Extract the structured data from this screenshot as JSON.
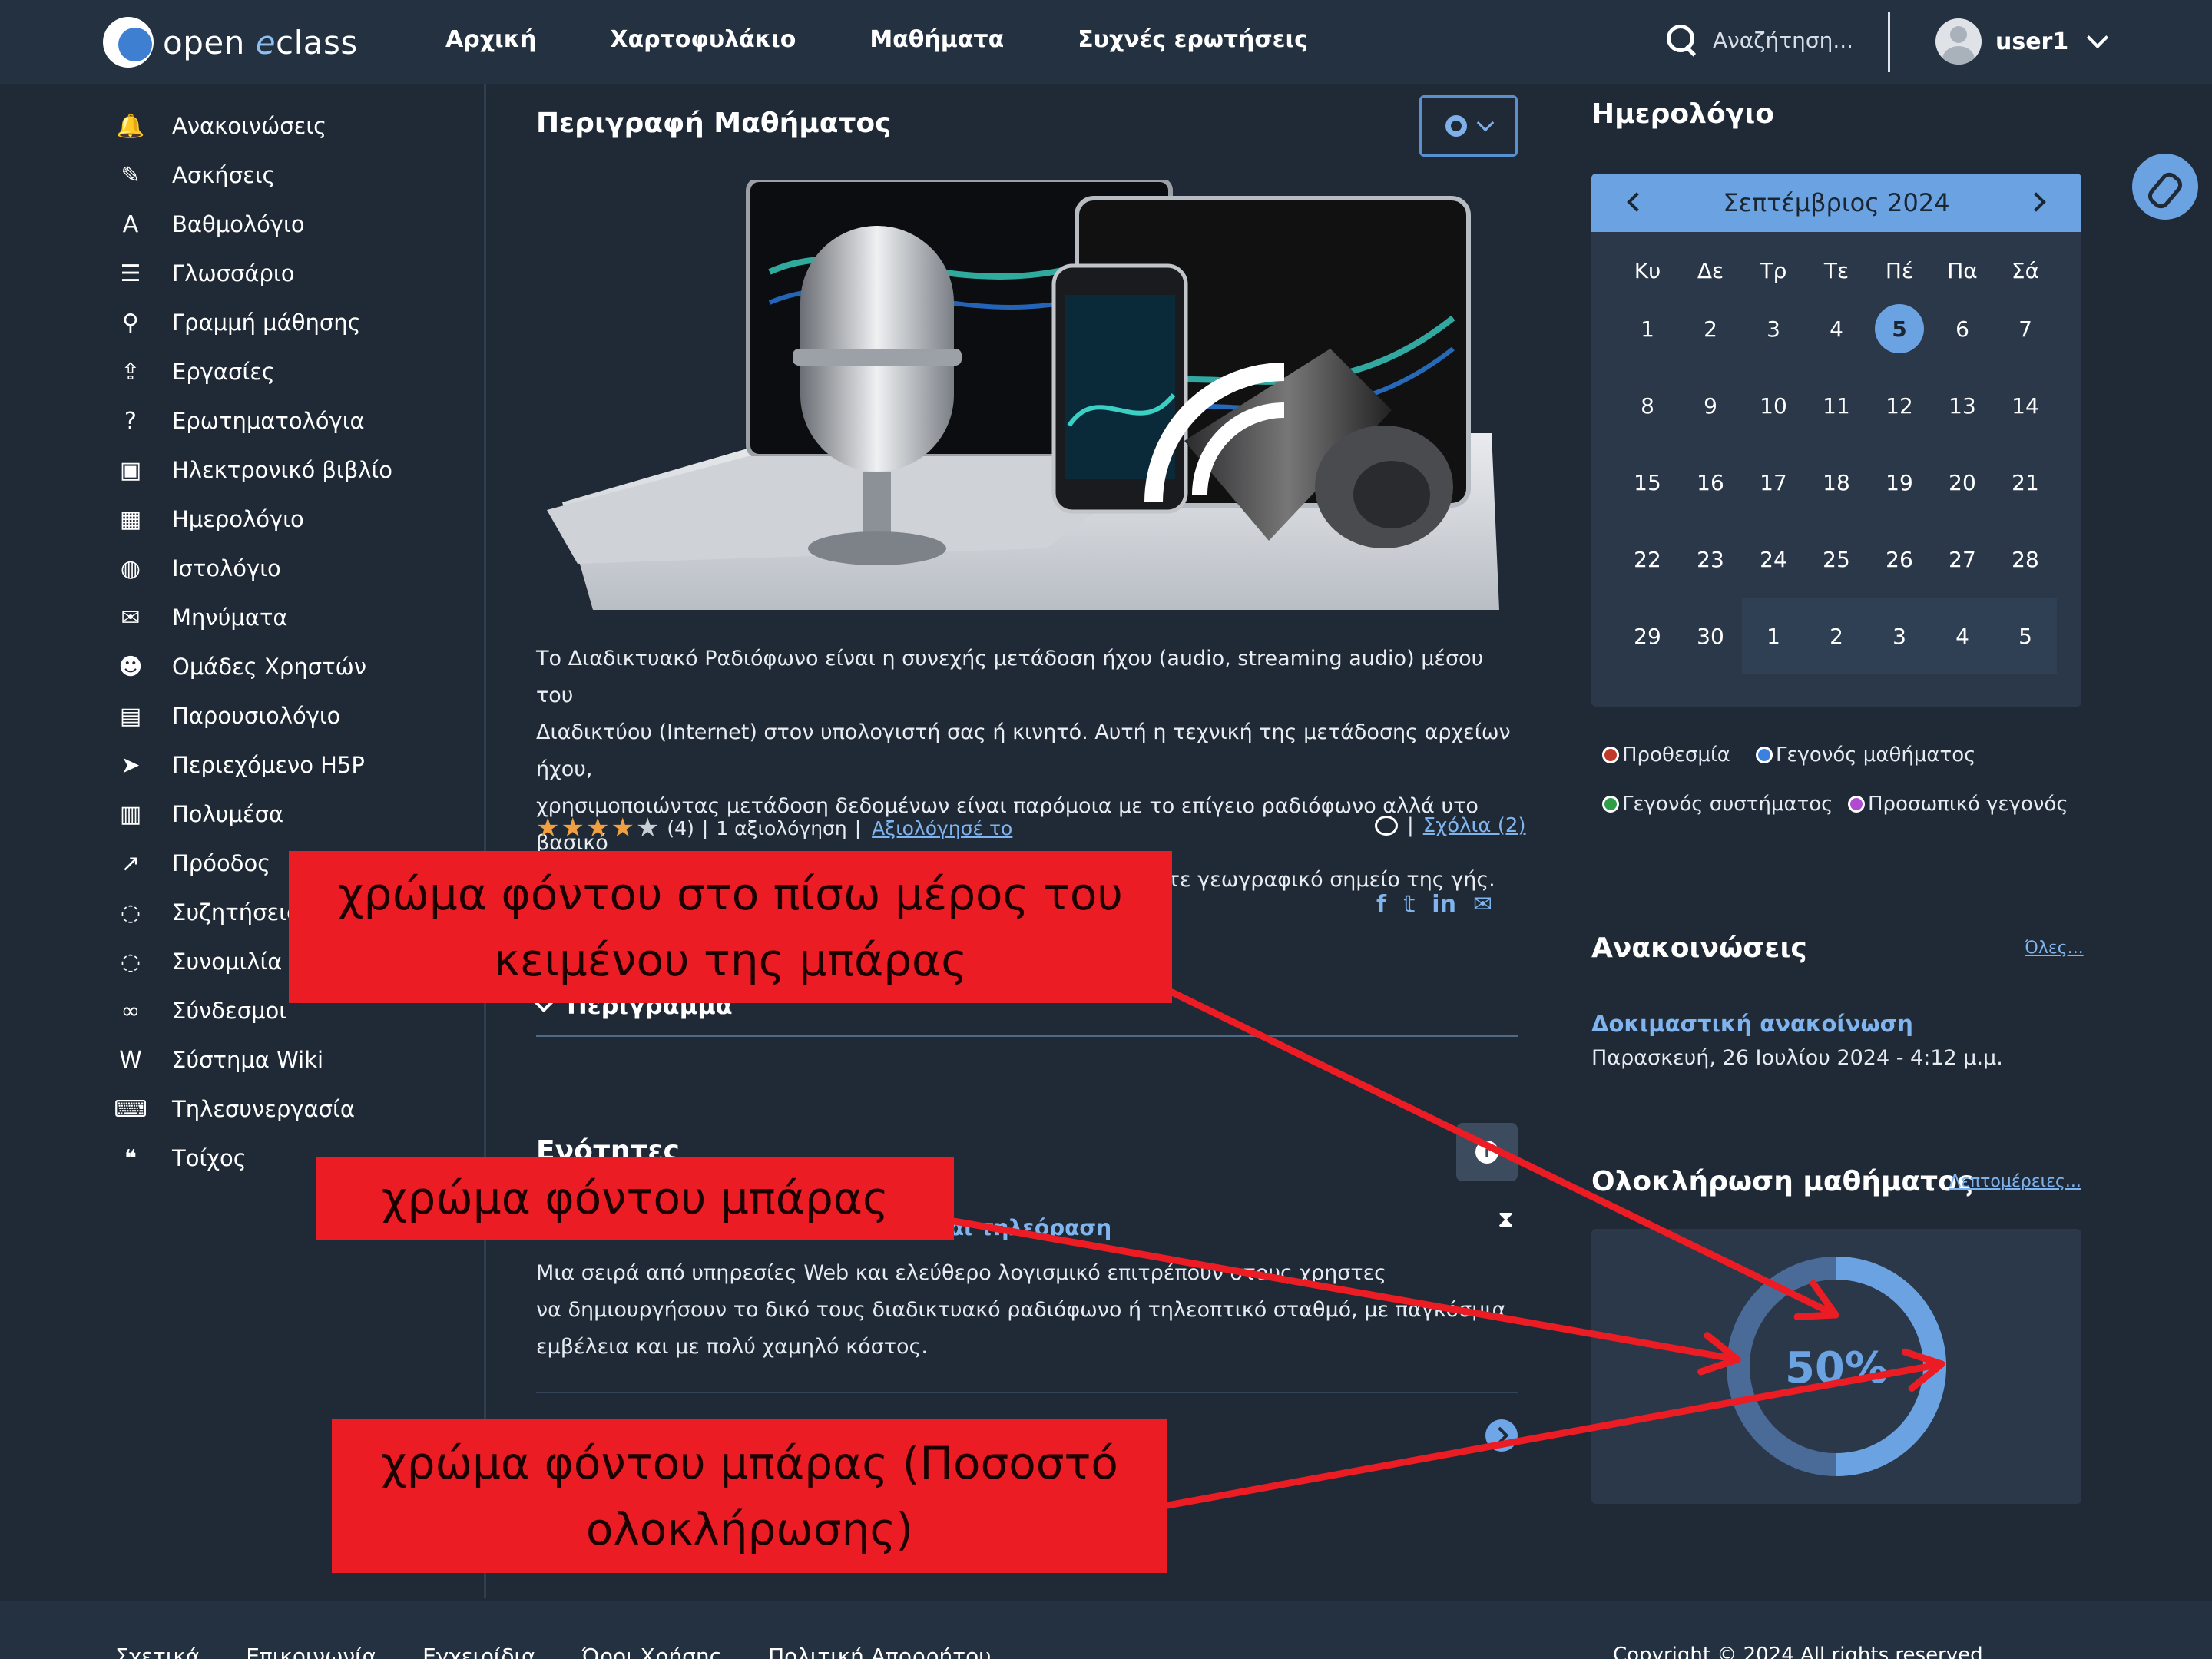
{
  "header": {
    "logo_prefix": "open",
    "logo_e": "e",
    "logo_suffix": "class",
    "nav": [
      "Αρχική",
      "Χαρτοφυλάκιο",
      "Μαθήματα",
      "Συχνές ερωτήσεις"
    ],
    "search_placeholder": "Αναζήτηση...",
    "user": "user1"
  },
  "sidebar": {
    "items": [
      {
        "label": "Ανακοινώσεις",
        "icon": "bell-icon",
        "glyph": "🔔"
      },
      {
        "label": "Ασκήσεις",
        "icon": "edit-file-icon",
        "glyph": "✎"
      },
      {
        "label": "Βαθμολόγιο",
        "icon": "grade-a-icon",
        "glyph": "A"
      },
      {
        "label": "Γλωσσάριο",
        "icon": "list-icon",
        "glyph": "☰"
      },
      {
        "label": "Γραμμή μάθησης",
        "icon": "route-icon",
        "glyph": "⚲"
      },
      {
        "label": "Εργασίες",
        "icon": "upload-icon",
        "glyph": "⇪"
      },
      {
        "label": "Ερωτηματολόγια",
        "icon": "question-icon",
        "glyph": "?"
      },
      {
        "label": "Ηλεκτρονικό βιβλίο",
        "icon": "ebook-icon",
        "glyph": "▣"
      },
      {
        "label": "Ημερολόγιο",
        "icon": "calendar-icon",
        "glyph": "▦"
      },
      {
        "label": "Ιστολόγιο",
        "icon": "globe-icon",
        "glyph": "◍"
      },
      {
        "label": "Μηνύματα",
        "icon": "envelope-icon",
        "glyph": "✉"
      },
      {
        "label": "Ομάδες Χρηστών",
        "icon": "users-icon",
        "glyph": "☻"
      },
      {
        "label": "Παρουσιολόγιο",
        "icon": "clipboard-user-icon",
        "glyph": "▤"
      },
      {
        "label": "Περιεχόμενο H5P",
        "icon": "pointer-icon",
        "glyph": "➤"
      },
      {
        "label": "Πολυμέσα",
        "icon": "film-icon",
        "glyph": "▥"
      },
      {
        "label": "Πρόοδος",
        "icon": "trend-icon",
        "glyph": "↗"
      },
      {
        "label": "Συζητήσεις",
        "icon": "comment-icon",
        "glyph": "◌"
      },
      {
        "label": "Συνομιλία",
        "icon": "chat-icon",
        "glyph": "◌"
      },
      {
        "label": "Σύνδεσμοι",
        "icon": "link-icon",
        "glyph": "∞"
      },
      {
        "label": "Σύστημα Wiki",
        "icon": "wiki-icon",
        "glyph": "W"
      },
      {
        "label": "Τηλεσυνεργασία",
        "icon": "keyboard-icon",
        "glyph": "⌨"
      },
      {
        "label": "Τοίχος",
        "icon": "quote-icon",
        "glyph": "❝"
      }
    ]
  },
  "main": {
    "title": "Περιγραφή Μαθήματος",
    "description_lines": [
      "Το Διαδικτυακό Ραδιόφωνο  είναι η συνεχής μετάδοση ήχου (audio, streaming audio) μέσου του",
      "Διαδικτύου (Internet) στον υπολογιστή σας ή κινητό. Αυτή η τεχνική της μετάδοσης αρχείων ήχου,",
      "χρησιμοποιώντας μετάδοση δεδομένων είναι παρόμοια με το επίγειο ραδιόφωνο αλλά υτο βασικό",
      "του πλεονέκτημα είναι οτι μπορεί να ακουστεί σε οποιοδήποτε γεωγραφικό σημείο της γής."
    ],
    "rating": {
      "stars": 4,
      "max_stars": 5,
      "count": "(4)",
      "separator": "|",
      "text": "1 αξιολόγηση",
      "link": "Αξιολόγησέ το"
    },
    "comments": {
      "separator": "|",
      "link": "Σχόλια (2)"
    },
    "share_icons": [
      "f",
      "𝕥",
      "in",
      "✉"
    ],
    "outline_label": "Περίγραμμα",
    "section_title": "Ενότητες",
    "unit_title": "και τηλεόραση",
    "unit_desc_lines": [
      "Μια σειρά από υπηρεσίες Web και ελεύθερο λογισμικό  επιτρέπουν στους χρηστες",
      "να δημιουργήσουν το δικό τους διαδικτυακό ραδιόφωνο ή τηλεοπτικό σταθμό, με παγκόσμια",
      "εμβέλεια και με πολύ χαμηλό κόστος."
    ]
  },
  "calendar": {
    "title": "Ημερολόγιο",
    "month": "Σεπτέμβριος 2024",
    "weekdays": [
      "Κυ",
      "Δε",
      "Τρ",
      "Τε",
      "Πέ",
      "Πα",
      "Σά"
    ],
    "weeks": [
      [
        "1",
        "2",
        "3",
        "4",
        "5",
        "6",
        "7"
      ],
      [
        "8",
        "9",
        "10",
        "11",
        "12",
        "13",
        "14"
      ],
      [
        "15",
        "16",
        "17",
        "18",
        "19",
        "20",
        "21"
      ],
      [
        "22",
        "23",
        "24",
        "25",
        "26",
        "27",
        "28"
      ],
      [
        "29",
        "30",
        "1",
        "2",
        "3",
        "4",
        "5"
      ]
    ],
    "today": "5",
    "legend": [
      {
        "label": "Προθεσμία",
        "color": "#c0392b"
      },
      {
        "label": "Γεγονός μαθήματος",
        "color": "#3b82e0"
      },
      {
        "label": "Γεγονός συστήματος",
        "color": "#2e9e48"
      },
      {
        "label": "Προσωπικό γεγονός",
        "color": "#b04ad0"
      }
    ]
  },
  "announcements": {
    "title": "Ανακοινώσεις",
    "all_link": "Όλες...",
    "item_title": "Δοκιμαστική ανακοίνωση",
    "item_date": "Παρασκευή, 26 Ιουλίου 2024 - 4:12 μ.μ."
  },
  "completion": {
    "title": "Ολοκλήρωση μαθήματος",
    "details_link": "Λεπτομέρειες...",
    "percent_label": "50%",
    "percent": 50,
    "colors": {
      "track": "#4a6a98",
      "fill": "#6aa2e2",
      "text": "#6aa2e2"
    }
  },
  "footer": {
    "links": [
      "Σχετικά",
      "Επικοινωνία",
      "Εγχειρίδια",
      "Όροι Χρήσης",
      "Πολιτική Απορρήτου"
    ],
    "copyright": "Copyright © 2024 All rights reserved"
  },
  "callouts": {
    "text_bg": [
      "χρώμα φόντου στο πίσω μέρος του",
      "κειμένου της μπάρας"
    ],
    "bar_bg": "χρώμα φόντου μπάρας",
    "bar_fill": [
      "χρώμα φόντου μπάρας (Ποσοστό",
      "ολοκλήρωσης)"
    ]
  },
  "colors": {
    "accent": "#6aa2e2",
    "page_bg": "#1f2a36",
    "header_bg": "#243141",
    "callout": "#ec1c24",
    "arrow": "#ec1c24"
  }
}
